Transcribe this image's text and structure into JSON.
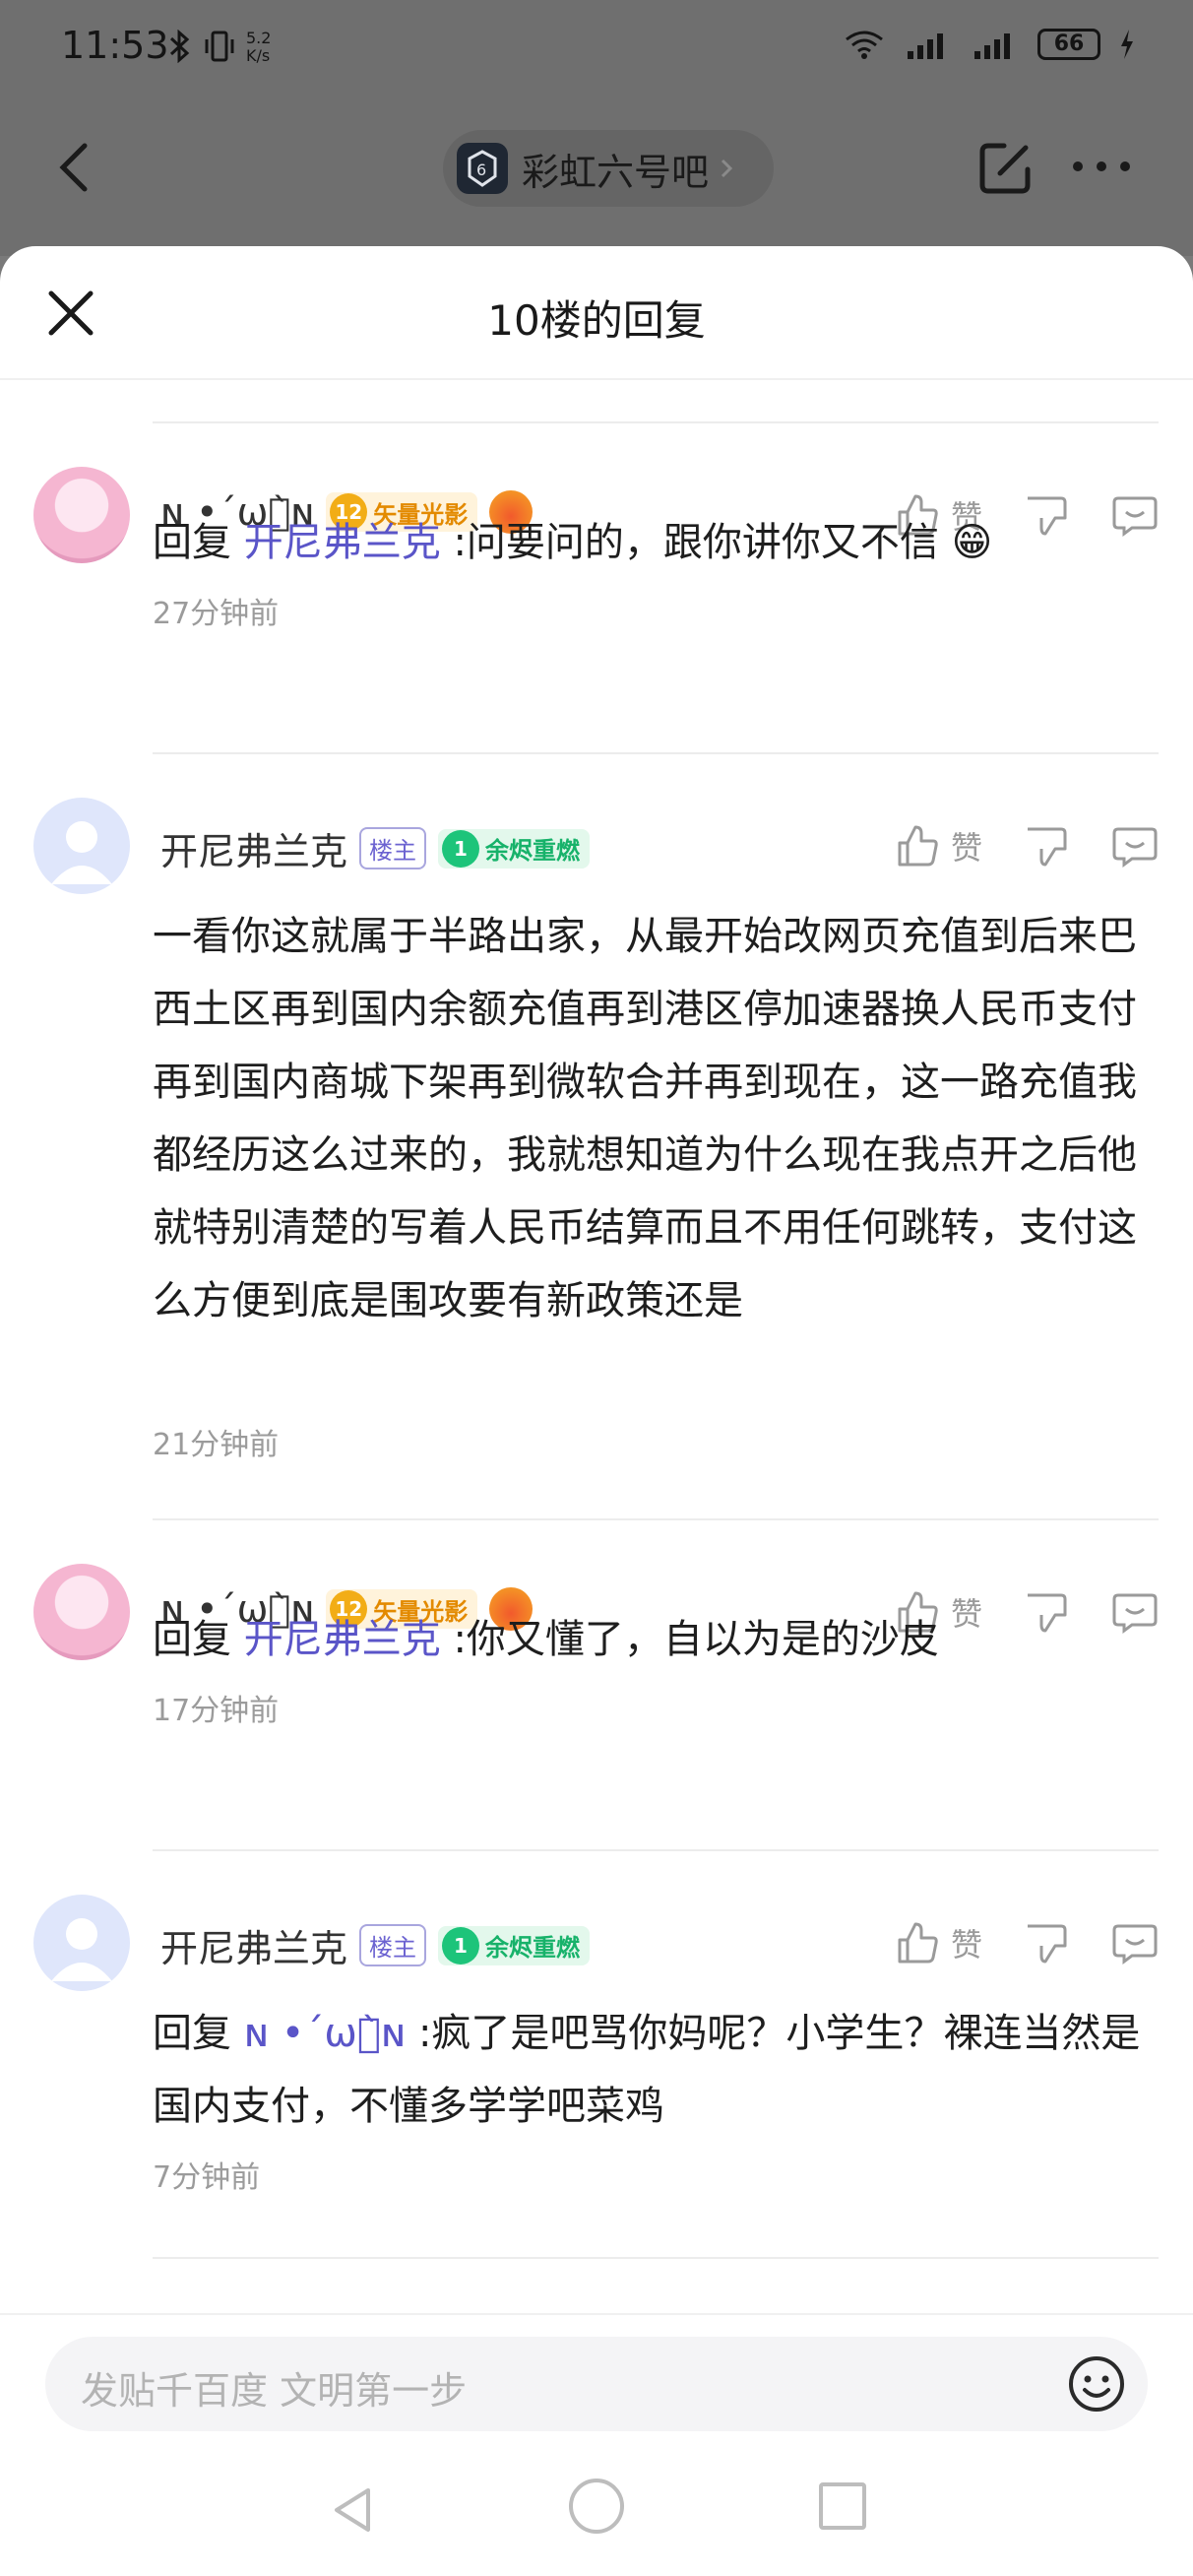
{
  "status_bar": {
    "time": "11:53",
    "net_speed_top": "5.2",
    "net_speed_bottom": "K/s",
    "battery": "66"
  },
  "nav": {
    "forum_name": "彩虹六号吧"
  },
  "sheet": {
    "title": "10楼的回复"
  },
  "replies": [
    {
      "username": "ɴ •´ωก̀ɴ",
      "level": "12",
      "level_title": "矢量光影",
      "reply_prefix": "回复",
      "mention": "开尼弗兰克",
      "text": ":问要问的，跟你讲你又不信 😁",
      "time": "27分钟前",
      "like_label": "赞"
    },
    {
      "username": "开尼弗兰克",
      "op_badge": "楼主",
      "level": "1",
      "level_title": "余烬重燃",
      "text": "一看你这就属于半路出家，从最开始改网页充值到后来巴西土区再到国内余额充值再到港区停加速器换人民币支付再到国内商城下架再到微软合并再到现在，这一路充值我都经历这么过来的，我就想知道为什么现在我点开之后他就特别清楚的写着人民币结算而且不用任何跳转，支付这么方便到底是围攻要有新政策还是",
      "time": "21分钟前",
      "like_label": "赞"
    },
    {
      "username": "ɴ •´ωก̀ɴ",
      "level": "12",
      "level_title": "矢量光影",
      "reply_prefix": "回复",
      "mention": "开尼弗兰克",
      "text": ":你又懂了，自以为是的沙皮",
      "time": "17分钟前",
      "like_label": "赞"
    },
    {
      "username": "开尼弗兰克",
      "op_badge": "楼主",
      "level": "1",
      "level_title": "余烬重燃",
      "reply_prefix": "回复",
      "mention": "ɴ •´ωก̀ɴ",
      "text": ":疯了是吧骂你妈呢？小学生？裸连当然是国内支付，不懂多学学吧菜鸡",
      "time": "7分钟前",
      "like_label": "赞"
    }
  ],
  "composer": {
    "placeholder": "发贴千百度 文明第一步"
  },
  "icons": {
    "back": "chevron-left-icon",
    "edit": "edit-icon",
    "more": "more-icon",
    "close": "close-icon",
    "like": "thumbs-up-icon",
    "dislike": "thumbs-down-icon",
    "comment": "comment-icon",
    "emoji": "emoji-icon"
  }
}
